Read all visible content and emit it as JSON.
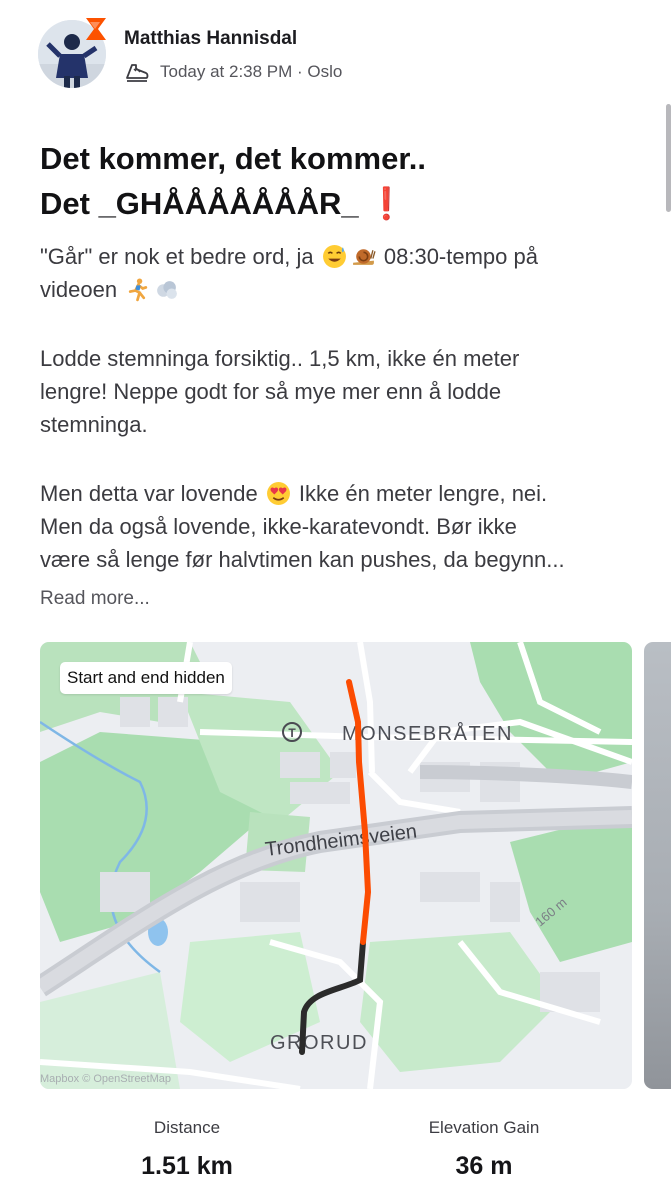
{
  "post": {
    "author_name": "Matthias Hannisdal",
    "meta": "Today at 2:38 PM · Oslo",
    "activity_icon": "running-shoe-icon",
    "title_lines": [
      "Det kommer, det kommer..",
      "Det _GHÅÅÅÅÅÅÅR_ "
    ],
    "title_emoji": "❗",
    "paragraph1": {
      "line1_a": "\"Går\" er nok et bedre ord, ja ",
      "line1_b": " 08:30-tempo på",
      "line2": "videoen "
    },
    "paragraph2_lines": [
      "Lodde stemninga forsiktig.. 1,5 km, ikke én meter",
      "lengre! Neppe godt for så mye mer enn å lodde",
      "stemninga."
    ],
    "paragraph3": {
      "line1_a": "Men detta var lovende ",
      "line1_b": " Ikke én meter lengre, nei.",
      "line2": "Men da også lovende, ikke-karatevondt. Bør ikke",
      "line3": "være så lenge før halvtimen kan pushes, da begynn..."
    },
    "read_more": "Read more..."
  },
  "map": {
    "badge": "Start and end hidden",
    "labels": {
      "neighborhood_top": "MONSEBRÅTEN",
      "road": "Trondheimsveien",
      "neighborhood_bottom": "GRORUD",
      "elevation": "160 m",
      "metro": "T"
    },
    "attribution": "Mapbox © OpenStreetMap",
    "colors": {
      "route": "#fc4c02",
      "hidden_route": "#2b2b2b",
      "park": "#a9ddb0",
      "road": "#cfd1d6"
    }
  },
  "stats": [
    {
      "label": "Distance",
      "value": "1.51 km"
    },
    {
      "label": "Elevation Gain",
      "value": "36 m"
    }
  ]
}
